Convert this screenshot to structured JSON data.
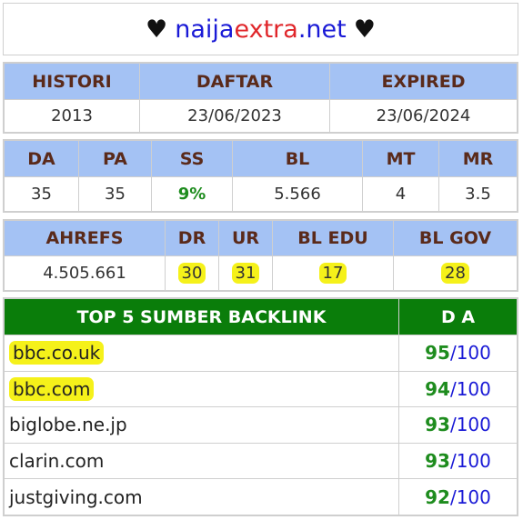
{
  "header": {
    "heart_left": "♥",
    "heart_right": "♥",
    "site_part1": "naija",
    "site_part2": "extra",
    "site_part3": ".net"
  },
  "domain_info": {
    "headers": [
      "HISTORI",
      "DAFTAR",
      "EXPIRED"
    ],
    "values": [
      "2013",
      "23/06/2023",
      "23/06/2024"
    ]
  },
  "metrics": {
    "headers": [
      "DA",
      "PA",
      "SS",
      "BL",
      "MT",
      "MR"
    ],
    "values": [
      "35",
      "35",
      "9%",
      "5.566",
      "4",
      "3.5"
    ]
  },
  "ahrefs": {
    "headers": [
      "AHREFS",
      "DR",
      "UR",
      "BL EDU",
      "BL GOV"
    ],
    "values": [
      "4.505.661",
      "30",
      "31",
      "17",
      "28"
    ]
  },
  "backlinks": {
    "header_source": "TOP 5 SUMBER BACKLINK",
    "header_da": "D A",
    "rows": [
      {
        "site": "bbc.co.uk",
        "score": "95",
        "max": "/100"
      },
      {
        "site": "bbc.com",
        "score": "94",
        "max": "/100"
      },
      {
        "site": "biglobe.ne.jp",
        "score": "93",
        "max": "/100"
      },
      {
        "site": "clarin.com",
        "score": "93",
        "max": "/100"
      },
      {
        "site": "justgiving.com",
        "score": "92",
        "max": "/100"
      }
    ]
  },
  "colors": {
    "header_bg": "#a4c2f4",
    "backlink_header_bg": "#0a7d0a",
    "highlight": "#f5f11a",
    "score_green": "#1e8c1e",
    "max_blue": "#1a1ad6"
  }
}
